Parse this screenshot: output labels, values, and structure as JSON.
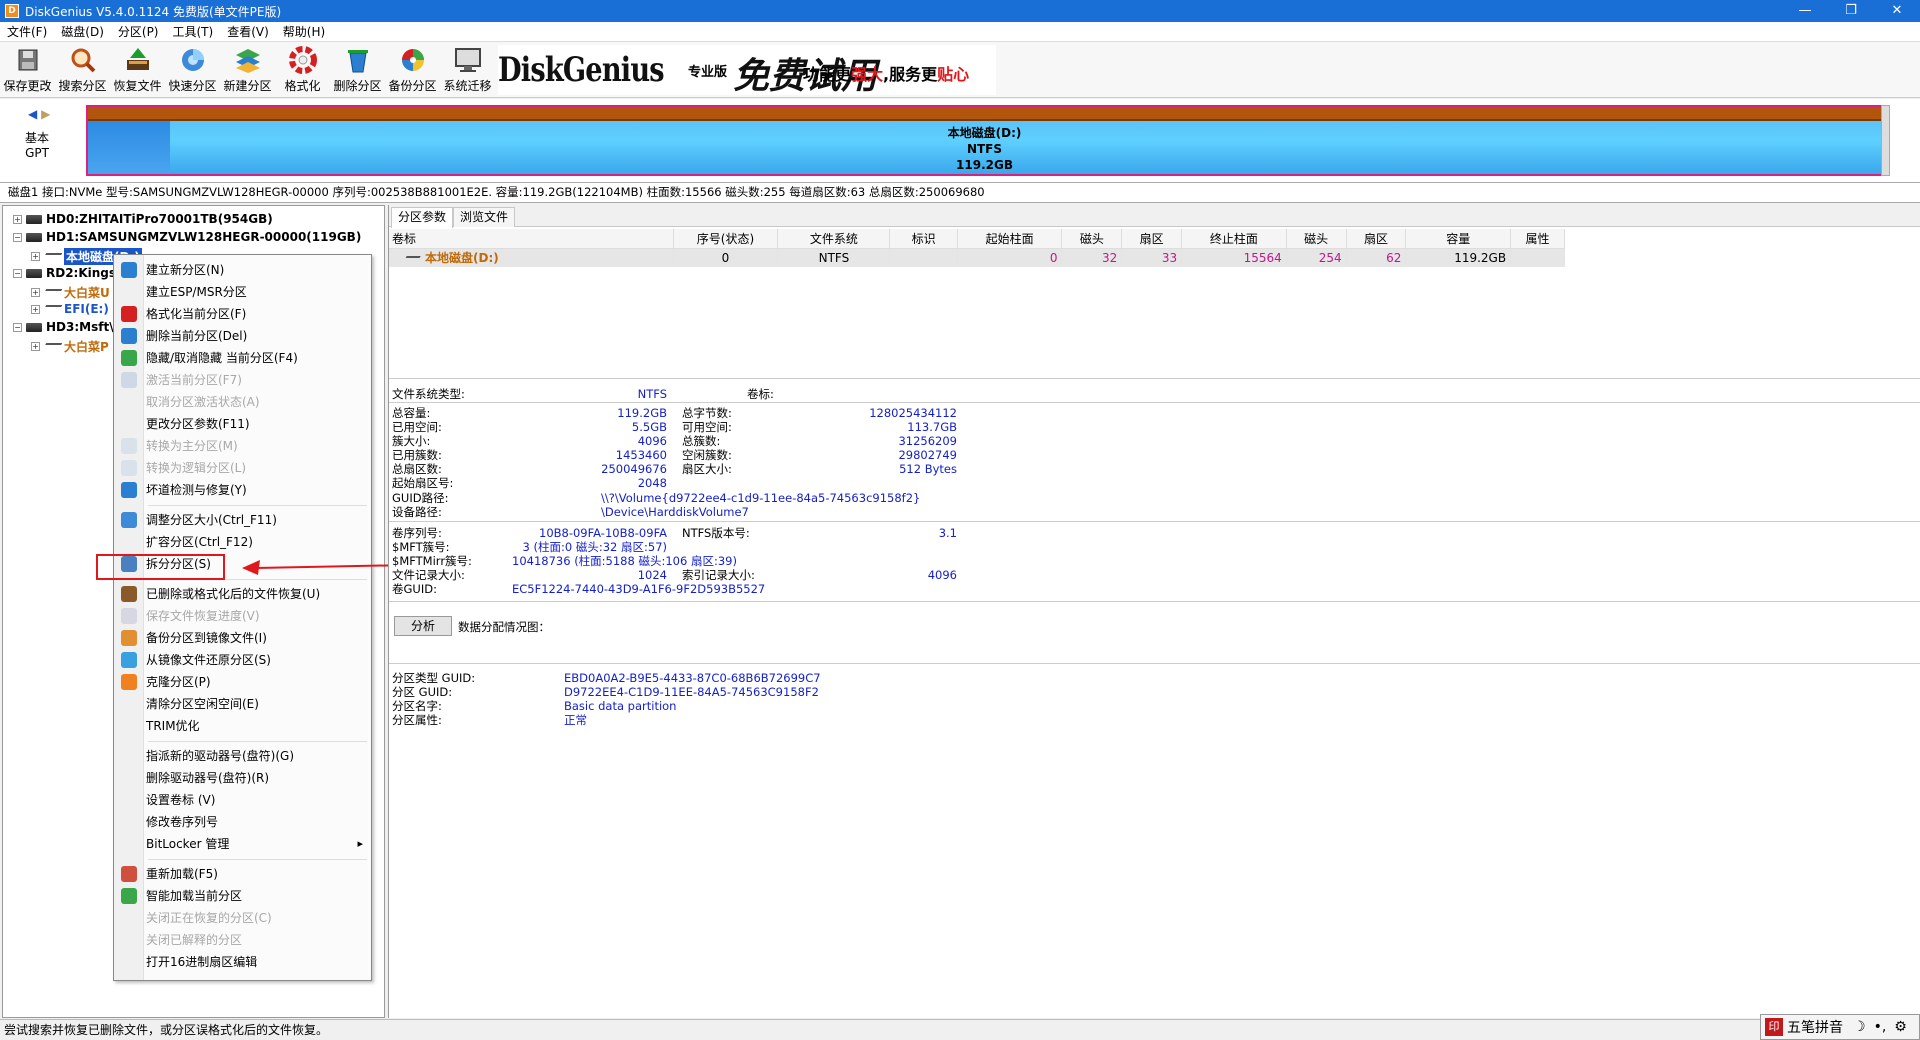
{
  "window": {
    "title": "DiskGenius V5.4.0.1124 免费版(单文件PE版)",
    "icon_text": "D"
  },
  "menu": [
    "文件(F)",
    "磁盘(D)",
    "分区(P)",
    "工具(T)",
    "查看(V)",
    "帮助(H)"
  ],
  "toolbar": [
    {
      "label": "保存更改",
      "icon": "save-icon"
    },
    {
      "label": "搜索分区",
      "icon": "search-icon"
    },
    {
      "label": "恢复文件",
      "icon": "recover-icon"
    },
    {
      "label": "快速分区",
      "icon": "quick-partition-icon"
    },
    {
      "label": "新建分区",
      "icon": "new-partition-icon"
    },
    {
      "label": "格式化",
      "icon": "format-icon"
    },
    {
      "label": "删除分区",
      "icon": "delete-icon"
    },
    {
      "label": "备份分区",
      "icon": "backup-icon"
    },
    {
      "label": "系统迁移",
      "icon": "migrate-icon"
    }
  ],
  "banner": {
    "logo": "DiskGenius",
    "edition": "专业版",
    "free": "免费试用",
    "slogan_a": "功能更",
    "slogan_b": "强大",
    "slogan_c": ",服务更",
    "slogan_d": "贴心"
  },
  "diskmap": {
    "kind_line1": "基本",
    "kind_line2": "GPT",
    "part_name": "本地磁盘(D:)",
    "part_fs": "NTFS",
    "part_size": "119.2GB"
  },
  "diskinfo": "磁盘1 接口:NVMe  型号:SAMSUNGMZVLW128HEGR-00000  序列号:002538B881001E2E.  容量:119.2GB(122104MB) 柱面数:15566  磁头数:255  每道扇区数:63  总扇区数:250069680",
  "tree": [
    {
      "text": "HD0:ZHITAITiPro70001TB(954GB)",
      "bold": true
    },
    {
      "text": "HD1:SAMSUNGMZVLW128HEGR-00000(119GB)",
      "bold": true
    },
    {
      "text": "本地磁盘(D:)"
    },
    {
      "text": "RD2:Kings",
      "bold": true
    },
    {
      "text": "大白菜U"
    },
    {
      "text": "EFI(E:)"
    },
    {
      "text": "HD3:Msft\\",
      "bold": true
    },
    {
      "text": "大白菜P"
    }
  ],
  "context_menu": [
    {
      "label": "建立新分区(N)",
      "icon": "new-partition-icon",
      "enabled": true
    },
    {
      "label": "建立ESP/MSR分区",
      "icon": "",
      "enabled": true
    },
    {
      "label": "格式化当前分区(F)",
      "icon": "format-icon",
      "enabled": true
    },
    {
      "label": "删除当前分区(Del)",
      "icon": "delete-icon",
      "enabled": true
    },
    {
      "label": "隐藏/取消隐藏 当前分区(F4)",
      "icon": "hide-icon",
      "enabled": true
    },
    {
      "label": "激活当前分区(F7)",
      "icon": "activate-icon",
      "enabled": false
    },
    {
      "label": "取消分区激活状态(A)",
      "icon": "",
      "enabled": false
    },
    {
      "label": "更改分区参数(F11)",
      "icon": "",
      "enabled": true
    },
    {
      "label": "转换为主分区(M)",
      "icon": "convert-icon",
      "enabled": false
    },
    {
      "label": "转换为逻辑分区(L)",
      "icon": "convert-icon",
      "enabled": false
    },
    {
      "label": "坏道检测与修复(Y)",
      "icon": "tools-icon",
      "enabled": true
    },
    {
      "label": "调整分区大小(Ctrl_F11)",
      "icon": "resize-icon",
      "enabled": true,
      "sep_before": true
    },
    {
      "label": "扩容分区(Ctrl_F12)",
      "icon": "",
      "enabled": true
    },
    {
      "label": "拆分分区(S)",
      "icon": "split-icon",
      "enabled": true
    },
    {
      "label": "已删除或格式化后的文件恢复(U)",
      "icon": "recover-icon",
      "enabled": true,
      "sep_before": true
    },
    {
      "label": "保存文件恢复进度(V)",
      "icon": "save-icon",
      "enabled": false
    },
    {
      "label": "备份分区到镜像文件(I)",
      "icon": "backup-icon",
      "enabled": true
    },
    {
      "label": "从镜像文件还原分区(S)",
      "icon": "restore-icon",
      "enabled": true
    },
    {
      "label": "克隆分区(P)",
      "icon": "clone-icon",
      "enabled": true
    },
    {
      "label": "清除分区空闲空间(E)",
      "icon": "",
      "enabled": true
    },
    {
      "label": "TRIM优化",
      "icon": "",
      "enabled": true
    },
    {
      "label": "指派新的驱动器号(盘符)(G)",
      "icon": "",
      "enabled": true,
      "sep_before": true
    },
    {
      "label": "删除驱动器号(盘符)(R)",
      "icon": "",
      "enabled": true
    },
    {
      "label": "设置卷标 (V)",
      "icon": "",
      "enabled": true
    },
    {
      "label": "修改卷序列号",
      "icon": "",
      "enabled": true
    },
    {
      "label": "BitLocker 管理",
      "icon": "",
      "enabled": true,
      "submenu": true
    },
    {
      "label": "重新加载(F5)",
      "icon": "reload-icon",
      "enabled": true,
      "sep_before": true
    },
    {
      "label": "智能加载当前分区",
      "icon": "smart-load-icon",
      "enabled": true
    },
    {
      "label": "关闭正在恢复的分区(C)",
      "icon": "",
      "enabled": false
    },
    {
      "label": "关闭已解释的分区",
      "icon": "",
      "enabled": false
    },
    {
      "label": "打开16进制扇区编辑",
      "icon": "",
      "enabled": true
    }
  ],
  "tabs": [
    "分区参数",
    "浏览文件"
  ],
  "ptable": {
    "headers": [
      "卷标",
      "序号(状态)",
      "文件系统",
      "标识",
      "起始柱面",
      "磁头",
      "扇区",
      "终止柱面",
      "磁头",
      "扇区",
      "容量",
      "属性"
    ],
    "row": [
      "本地磁盘(D:)",
      "0",
      "NTFS",
      "",
      "0",
      "32",
      "33",
      "15564",
      "254",
      "62",
      "119.2GB",
      ""
    ]
  },
  "fsinfo": {
    "fs_type_label": "文件系统类型:",
    "fs_type": "NTFS",
    "vol_label_label": "卷标:",
    "rows_a": [
      [
        "总容量:",
        "119.2GB",
        "总字节数:",
        "128025434112"
      ],
      [
        "已用空间:",
        "5.5GB",
        "可用空间:",
        "113.7GB"
      ],
      [
        "簇大小:",
        "4096",
        "总簇数:",
        "31256209"
      ],
      [
        "已用簇数:",
        "1453460",
        "空闲簇数:",
        "29802749"
      ],
      [
        "总扇区数:",
        "250049676",
        "扇区大小:",
        "512 Bytes"
      ],
      [
        "起始扇区号:",
        "2048",
        "",
        ""
      ]
    ],
    "guid_path_label": "GUID路径:",
    "guid_path": "\\\\?\\Volume{d9722ee4-c1d9-11ee-84a5-74563c9158f2}",
    "dev_path_label": "设备路径:",
    "dev_path": "\\Device\\HarddiskVolume7",
    "rows_b": [
      [
        "卷序列号:",
        "10B8-09FA-10B8-09FA",
        "NTFS版本号:",
        "3.1"
      ],
      [
        "$MFT簇号:",
        "3 (柱面:0 磁头:32 扇区:57)",
        "",
        ""
      ],
      [
        "$MFTMirr簇号:",
        "10418736 (柱面:5188 磁头:106 扇区:39)",
        "",
        ""
      ],
      [
        "文件记录大小:",
        "1024",
        "索引记录大小:",
        "4096"
      ],
      [
        "卷GUID:",
        "EC5F1224-7440-43D9-A1F6-9F2D593B5527",
        "",
        ""
      ]
    ],
    "analyze_btn": "分析",
    "alloc_label": "数据分配情况图：",
    "rows_c": [
      [
        "分区类型 GUID:",
        "EBD0A0A2-B9E5-4433-87C0-68B6B72699C7"
      ],
      [
        "分区 GUID:",
        "D9722EE4-C1D9-11EE-84A5-74563C9158F2"
      ],
      [
        "分区名字:",
        "Basic data partition"
      ],
      [
        "分区属性:",
        "正常"
      ]
    ]
  },
  "status": "尝试搜索并恢复已删除文件，或分区误格式化后的文件恢复。",
  "ime": {
    "label": "五笔拼音",
    "icon_text": "印"
  },
  "colors": {
    "title_bar": "#1a6fd6",
    "partition_border": "#d9217d",
    "highlight_box": "#e0181b",
    "value_blue": "#1521c8"
  }
}
